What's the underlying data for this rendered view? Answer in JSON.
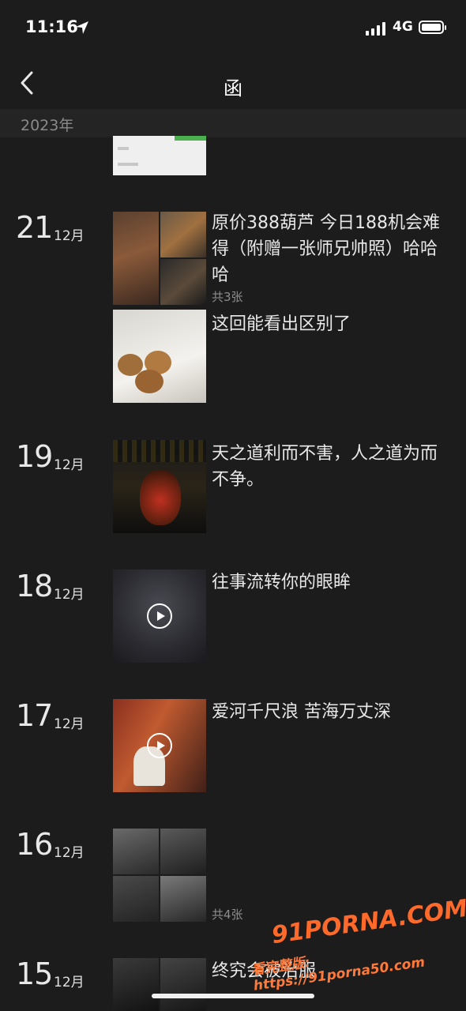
{
  "status": {
    "time": "11:16",
    "network": "4G"
  },
  "nav": {
    "title": "函"
  },
  "year": "2023年",
  "posts": [
    {
      "day": "21",
      "month": "12月",
      "items": [
        {
          "caption": "原价388葫芦 今日188机会难得（附赠一张师兄帅照）哈哈哈",
          "count": "共3张"
        },
        {
          "caption": "这回能看出区别了",
          "count": ""
        }
      ]
    },
    {
      "day": "19",
      "month": "12月",
      "items": [
        {
          "caption": "天之道利而不害，人之道为而不争。",
          "count": ""
        }
      ]
    },
    {
      "day": "18",
      "month": "12月",
      "items": [
        {
          "caption": "往事流转你的眼眸",
          "count": ""
        }
      ]
    },
    {
      "day": "17",
      "month": "12月",
      "items": [
        {
          "caption": "爱河千尺浪 苦海万丈深",
          "count": ""
        }
      ]
    },
    {
      "day": "16",
      "month": "12月",
      "items": [
        {
          "caption": "",
          "count": "共4张"
        }
      ]
    },
    {
      "day": "15",
      "month": "12月",
      "items": [
        {
          "caption": "终究会被治服",
          "count": ""
        }
      ]
    }
  ],
  "watermark": {
    "line1": "91PORNA.COM",
    "line2": "看完整版: https://91porna50.com"
  }
}
